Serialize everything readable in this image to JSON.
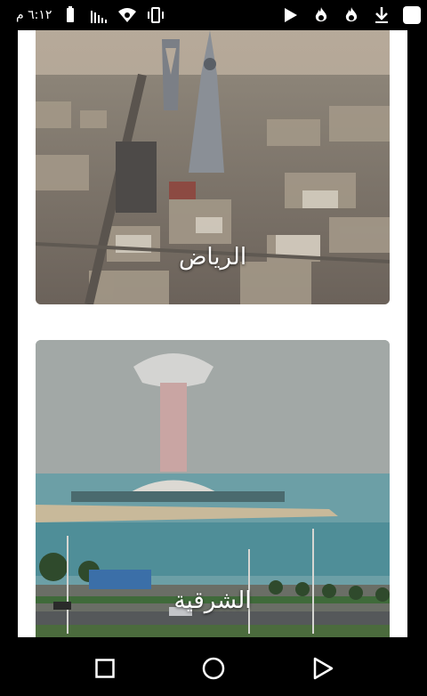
{
  "status_bar": {
    "time": "٦:١٢ م",
    "icons": [
      "battery-icon",
      "signal-icon",
      "wifi-icon",
      "vibrate-icon",
      "play-store-icon",
      "tinder-icon",
      "tinder-icon",
      "download-icon",
      "app-icon"
    ]
  },
  "cities": [
    {
      "name": "الرياض"
    },
    {
      "name": "الشرقية"
    }
  ],
  "nav": {
    "buttons": [
      "recent-apps-icon",
      "home-icon",
      "back-icon"
    ]
  }
}
